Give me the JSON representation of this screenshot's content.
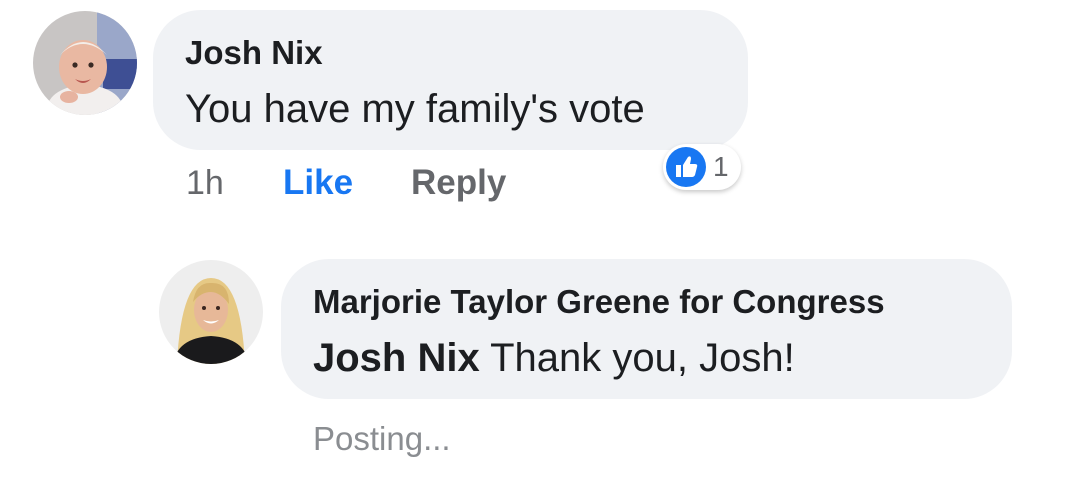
{
  "colors": {
    "bubble_background": "#f0f2f5",
    "primary_text": "#1c1e21",
    "secondary_text": "#65676b",
    "like_active": "#1877f2"
  },
  "comment": {
    "author": "Josh Nix",
    "text": "You have my family's vote",
    "avatar_icon": "baby-photo-avatar",
    "actions": {
      "time": "1h",
      "like_label": "Like",
      "reply_label": "Reply"
    },
    "reaction": {
      "icon": "thumbs-up-icon",
      "count": "1"
    }
  },
  "reply": {
    "author": "Marjorie Taylor Greene for Congress",
    "mention": "Josh Nix",
    "text": " Thank you, Josh!",
    "avatar_icon": "woman-portrait-avatar",
    "status": "Posting..."
  }
}
